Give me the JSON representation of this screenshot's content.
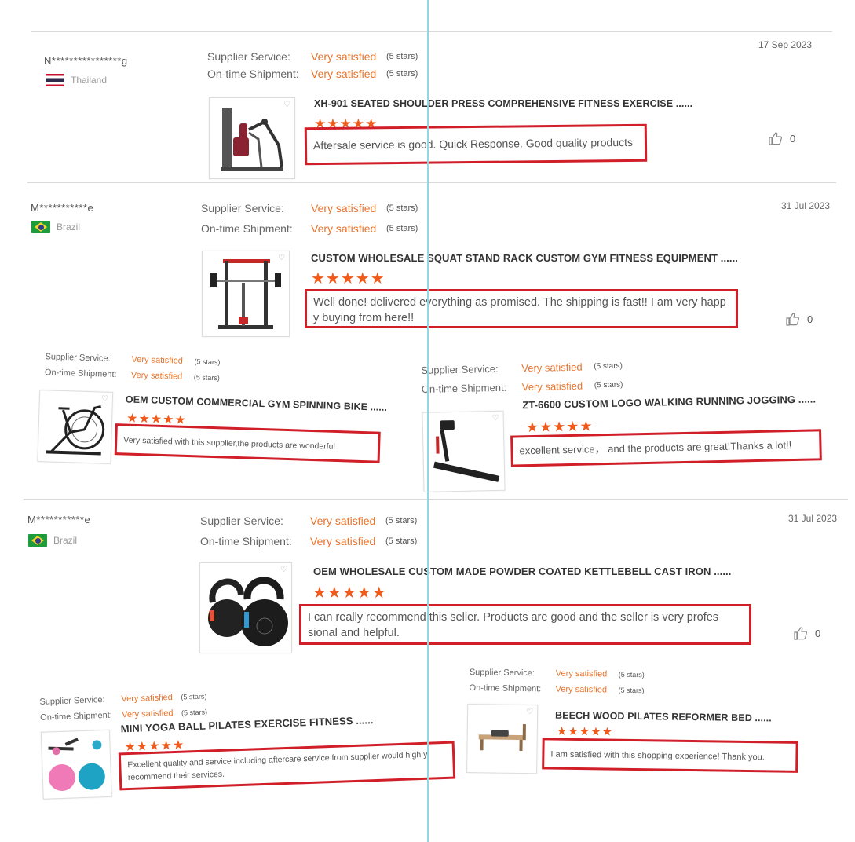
{
  "labels": {
    "supplier_service": "Supplier Service:",
    "ontime_shipment": "On-time Shipment:",
    "very_satisfied": "Very satisfied",
    "five_stars": "(5 stars)"
  },
  "colors": {
    "accent": "#e8742c",
    "highlight_box": "#d11f2a",
    "stars": "#f05a1a"
  },
  "stars_glyphs": "★★★★★",
  "reviews": [
    {
      "reviewer": "N****************g",
      "country": "Thailand",
      "flag": "thailand-flag",
      "date": "17 Sep 2023",
      "product": "XH-901 SEATED SHOULDER PRESS COMPREHENSIVE FITNESS EXERCISE ......",
      "comment": "Aftersale service is good. Quick Response. Good quality products",
      "likes": "0"
    },
    {
      "reviewer": "M***********e",
      "country": "Brazil",
      "flag": "brazil-flag",
      "date": "31 Jul 2023",
      "product": "CUSTOM WHOLESALE SQUAT STAND RACK CUSTOM GYM FITNESS EQUIPMENT ......",
      "comment": "Well done! delivered everything as promised. The shipping is fast!! I am very happ y buying from here!!",
      "likes": "0"
    },
    {
      "product": "OEM CUSTOM COMMERCIAL GYM SPINNING BIKE ......",
      "comment": "Very satisfied with this supplier,the products are wonderful"
    },
    {
      "product": "ZT-6600 CUSTOM LOGO WALKING RUNNING JOGGING ......",
      "comment": "excellent service，  and the products are great!Thanks a lot!!"
    },
    {
      "reviewer": "M***********e",
      "country": "Brazil",
      "flag": "brazil-flag",
      "date": "31 Jul 2023",
      "product": "OEM WHOLESALE CUSTOM MADE POWDER COATED KETTLEBELL CAST IRON ......",
      "comment": "I can really recommend this seller. Products are good and the seller is very profes sional and helpful.",
      "likes": "0"
    },
    {
      "product": "MINI YOGA BALL PILATES EXERCISE FITNESS ......",
      "comment": "Excellent quality and service including aftercare service from supplier would high y recommend their services."
    },
    {
      "product": "BEECH WOOD PILATES REFORMER BED ......",
      "comment": "I am satisfied with this shopping experience! Thank you."
    }
  ]
}
